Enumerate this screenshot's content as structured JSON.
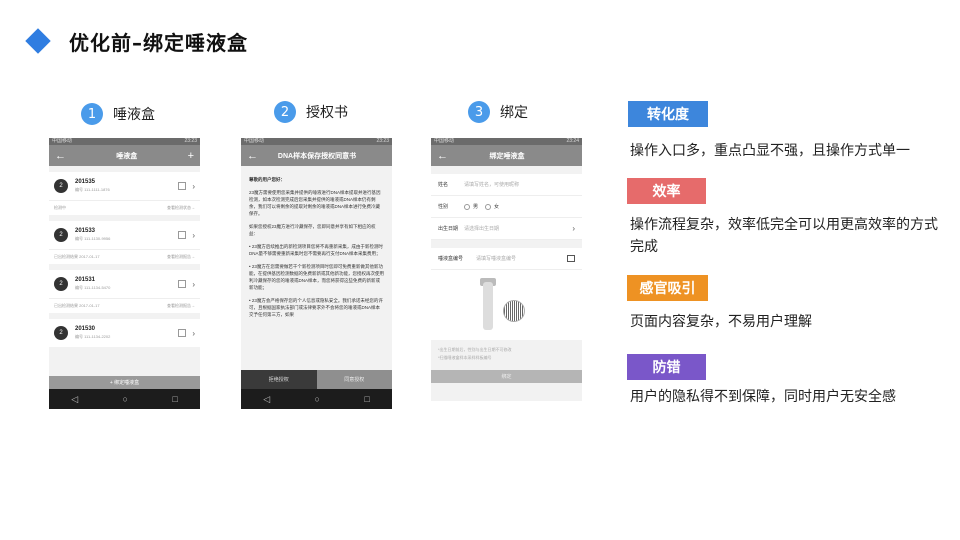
{
  "title": "优化前–绑定唾液盒",
  "steps": [
    {
      "num": "1",
      "label": "唾液盒"
    },
    {
      "num": "2",
      "label": "授权书"
    },
    {
      "num": "3",
      "label": "绑定"
    }
  ],
  "phone1": {
    "status_left": "中国移动",
    "status_right": "23:23",
    "back": "←",
    "title": "唾液盒",
    "add": "+",
    "cards": [
      {
        "avatar": "2",
        "id": "201535",
        "sub": "编号 111-1111-1876",
        "left": "检测中",
        "right": "查看检测状态→"
      },
      {
        "avatar": "2",
        "id": "201533",
        "sub": "编号 111-1130-9956",
        "left": "已出检测结果 2017-01-17",
        "right": "查看检测报告→"
      },
      {
        "avatar": "2",
        "id": "201531",
        "sub": "编号 111-1134-5470",
        "left": "已出检测结果 2017-01-17",
        "right": "查看检测报告→"
      },
      {
        "avatar": "2",
        "id": "201530",
        "sub": "编号 111-1134-2202",
        "left": "",
        "right": ""
      }
    ],
    "bind_button": "+ 绑定唾液盒"
  },
  "phone2": {
    "status_left": "中国移动",
    "status_right": "23:23",
    "back": "←",
    "title": "DNA样本保存授权同意书",
    "greeting": "尊敬的用户您好：",
    "paragraphs": [
      "23魔方需要使用您采集并提供的唾液进行DNA样本提取并进行基因检测，如本次检测完成后您采集并提供的唾液或DNA样本仍有剩余，我们可以将剩余的提取对剩余的唾液或DNA样本进行免费冷藏保存。",
      "如果您授权23魔方进行冷藏保存，您即同意并享有如下相应的权益：",
      "• 23魔方后续推出的新检测项目您将不再重新采集，成由于新检测时DNA量不够需要重新采集时您不需要再行支付DNA样本采集费用；",
      "• 23魔方在您需要做若干个新检测项目时您即可免费重新做其他新功能，在提供基因检测数据的免费新新或其他新功能，您授权再次使用利冷藏保存的您的唾液或DNA样本，而您将获得这些免费的新新或新功能；",
      "• 23魔方会严格保存您的个人信息或隐私安全。我们承诺未经您的许可，且根据国家执法部门或法律要求外不会将您的唾液或DNA样本交予任何第三方，如果"
    ],
    "decline": "拒绝授权",
    "agree": "同意授权"
  },
  "phone3": {
    "status_left": "中国移动",
    "status_right": "23:24",
    "back": "←",
    "title": "绑定唾液盒",
    "name_label": "姓名",
    "name_placeholder": "请填写姓名，可使用昵称",
    "gender_label": "性别",
    "gender_male": "男",
    "gender_female": "女",
    "birth_label": "出生日期",
    "birth_placeholder": "请选择出生日期",
    "box_label": "唾液盒编号",
    "box_placeholder": "请填写唾液盒编号",
    "hint1": "*出生日期前后，性别与出生日期不可修改",
    "hint2": "*扫描唾液盒样本采样样板编号",
    "submit": "绑定"
  },
  "issues": [
    {
      "tag": "转化度",
      "color": "#3d86dc",
      "text": "操作入口多，重点凸显不强，且操作方式单一"
    },
    {
      "tag": "效率",
      "color": "#e66b6b",
      "text": "操作流程复杂，效率低完全可以用更高效率的方式完成"
    },
    {
      "tag": "感官吸引",
      "color": "#ee9223",
      "text": "页面内容复杂，不易用户理解"
    },
    {
      "tag": "防错",
      "color": "#7a57c9",
      "text": "用户的隐私得不到保障，同时用户无安全感"
    }
  ]
}
